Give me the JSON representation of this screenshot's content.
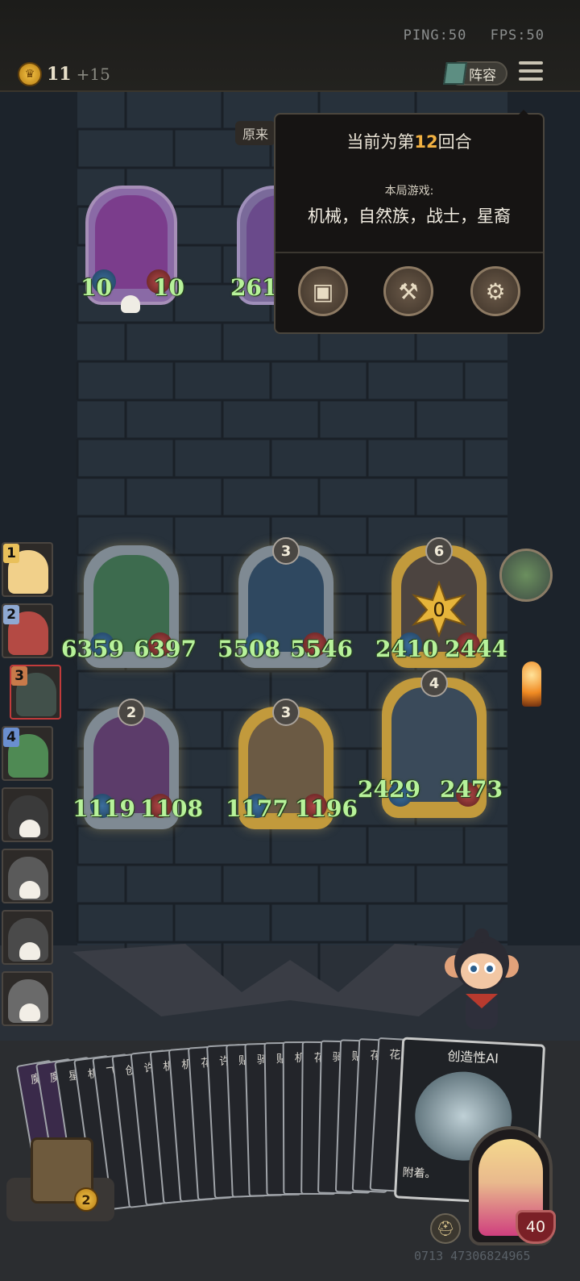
{
  "topbar": {
    "ping": "PING:50",
    "fps": "FPS:50",
    "gold": "11",
    "gold_plus": "+15",
    "lineup_label": "阵容"
  },
  "tag": "原来",
  "popup": {
    "round_prefix": "当前为第",
    "round_num": "12",
    "round_suffix": "回合",
    "game_label": "本局游戏:",
    "tribes": "机械，自然族，战士，星裔"
  },
  "board_top": [
    {
      "atk": "10",
      "hp": "10",
      "color": "#7b3d8c"
    },
    {
      "atk": "261",
      "color": "#6a4a8b"
    }
  ],
  "board": [
    {
      "level": "",
      "atk": "6359",
      "hp": "6397",
      "frame": "#7f8a93",
      "art": "#3d6b4e"
    },
    {
      "level": "3",
      "atk": "5508",
      "hp": "5546",
      "frame": "#7f8a93",
      "art": "#2f4860"
    },
    {
      "level": "6",
      "atk": "2410",
      "hp": "2444",
      "frame": "#c29a3c",
      "art": "#4c4440",
      "dmg": "0"
    },
    {
      "level": "2",
      "atk": "1119",
      "hp": "1108",
      "frame": "#7f8a93",
      "art": "#5c3c6a"
    },
    {
      "level": "3",
      "atk": "1177",
      "hp": "1196",
      "frame": "#c29a3c",
      "art": "#6b5a44"
    },
    {
      "level": "4",
      "atk": "2429",
      "hp": "2473",
      "frame": "#c29a3c",
      "art": "#3a4a5a"
    }
  ],
  "players": [
    {
      "rank": "1",
      "color": "#e9c05a",
      "face": "#f1d08a"
    },
    {
      "rank": "2",
      "color": "#8fa9d2",
      "face": "#b44a44"
    },
    {
      "rank": "3",
      "color": "#c87a4a",
      "face": "#41504a"
    },
    {
      "rank": "4",
      "color": "#6a8fd0",
      "face": "#4f8a54"
    },
    {
      "rank": "",
      "color": "",
      "face": "#3a3a3a"
    },
    {
      "rank": "",
      "color": "",
      "face": "#5a5a5a"
    },
    {
      "rank": "",
      "color": "",
      "face": "#4a4a4a"
    },
    {
      "rank": "",
      "color": "",
      "face": "#6a6a6a"
    }
  ],
  "hand": [
    "魔",
    "魔",
    "星",
    "机",
    "飞",
    "创",
    "许",
    "机",
    "机",
    "花",
    "许",
    "贴",
    "骑",
    "贴",
    "机",
    "花",
    "骑",
    "贴",
    "花",
    "花"
  ],
  "featured_card": {
    "name": "创造性AI",
    "desc": "附着。"
  },
  "shop_count": "2",
  "hero_hp": "40",
  "seed": "0713 47306824965"
}
